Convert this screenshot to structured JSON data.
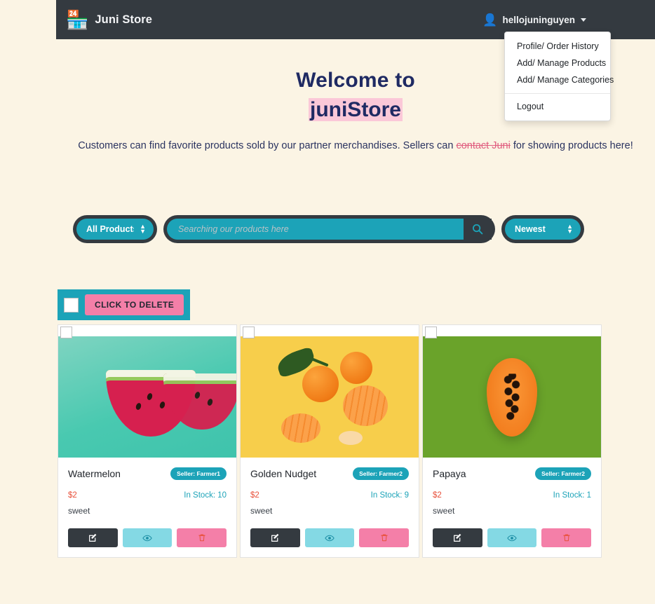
{
  "navbar": {
    "brand_icon": "store-icon",
    "brand_name": "Juni Store",
    "avatar_icon": "avatar-person-icon",
    "username": "hellojuninguyen"
  },
  "dropdown": {
    "items": [
      {
        "label": "Profile/ Order History"
      },
      {
        "label": "Add/ Manage Products"
      },
      {
        "label": "Add/ Manage Categories"
      }
    ],
    "logout_label": "Logout"
  },
  "hero": {
    "line1": "Welcome to",
    "line2": "juniStore",
    "desc_part1": "Customers can find favorite products sold by our partner merchandises. Sellers can ",
    "desc_link": "contact Juni",
    "desc_part2": " for showing products here!"
  },
  "search": {
    "category_selected": "All Products",
    "placeholder": "Searching our products here",
    "value": "",
    "search_icon": "magnifier-icon",
    "sort_selected": "Newest"
  },
  "delete_bar": {
    "button_label": "CLICK TO DELETE",
    "checkbox_checked": false
  },
  "products": [
    {
      "name": "Watermelon",
      "seller_badge": "Seller: Farmer1",
      "price": "$2",
      "stock": "In Stock: 10",
      "description": "sweet",
      "image": "watermelon-slices-on-mint-background",
      "actions": {
        "edit": "edit-icon",
        "view": "eye-icon",
        "delete": "trash-icon"
      }
    },
    {
      "name": "Golden Nudget",
      "seller_badge": "Seller: Farmer2",
      "price": "$2",
      "stock": "In Stock: 9",
      "description": "sweet",
      "image": "mandarin-oranges-on-yellow-background",
      "actions": {
        "edit": "edit-icon",
        "view": "eye-icon",
        "delete": "trash-icon"
      }
    },
    {
      "name": "Papaya",
      "seller_badge": "Seller: Farmer2",
      "price": "$2",
      "stock": "In Stock: 1",
      "description": "sweet",
      "image": "halved-papaya-on-green-background",
      "actions": {
        "edit": "edit-icon",
        "view": "eye-icon",
        "delete": "trash-icon"
      }
    }
  ],
  "colors": {
    "page_background": "#FBF4E4",
    "navbar": "#343A40",
    "teal": "#1CA3B8",
    "pink": "#F47FA8",
    "light_blue": "#84D9E4",
    "price_red": "#E8503A",
    "heading_navy": "#1F2A63",
    "highlight_pink": "#FBC8D8"
  }
}
